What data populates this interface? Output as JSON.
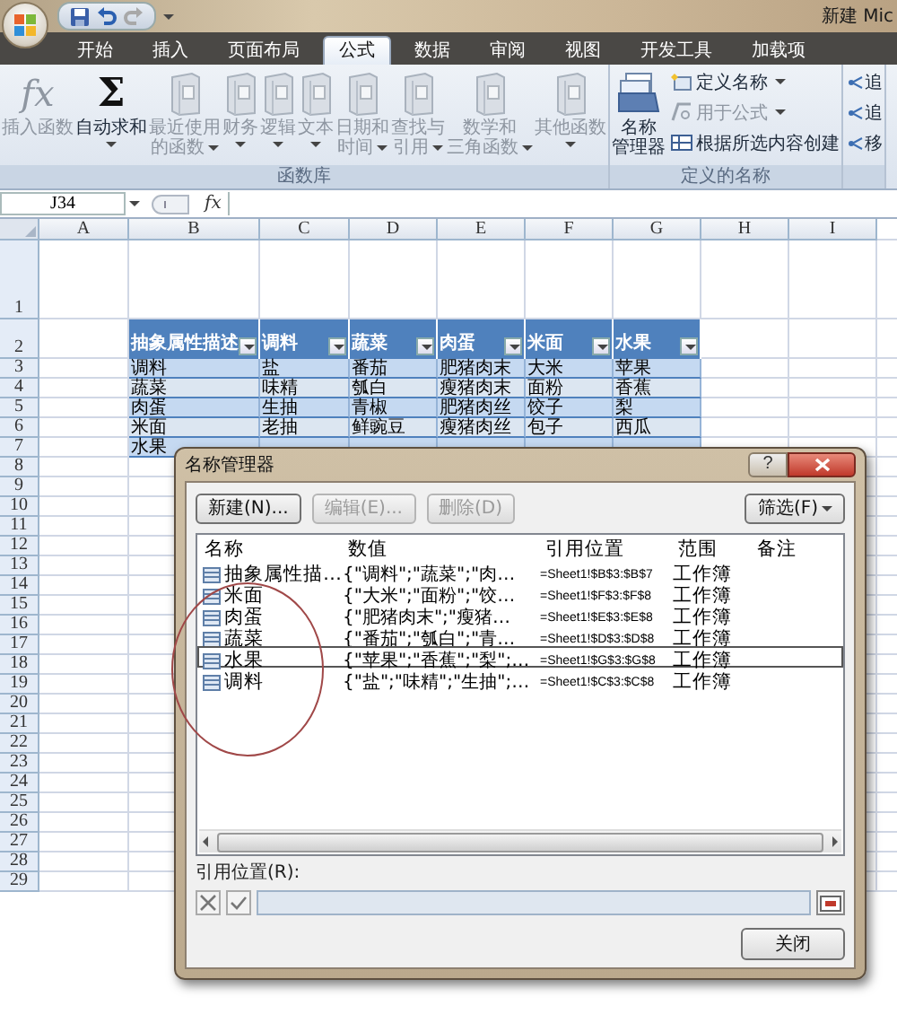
{
  "window": {
    "title": "新建 Mic"
  },
  "quick_access": [
    {
      "kind": "save",
      "disabled": false
    },
    {
      "kind": "undo",
      "disabled": false
    },
    {
      "kind": "redo",
      "disabled": true
    }
  ],
  "tabs": [
    {
      "label": "开始",
      "selected": false
    },
    {
      "label": "插入",
      "selected": false
    },
    {
      "label": "页面布局",
      "selected": false
    },
    {
      "label": "公式",
      "selected": true
    },
    {
      "label": "数据",
      "selected": false
    },
    {
      "label": "审阅",
      "selected": false
    },
    {
      "label": "视图",
      "selected": false
    },
    {
      "label": "开发工具",
      "selected": false
    },
    {
      "label": "加载项",
      "selected": false
    }
  ],
  "ribbon": {
    "groups": [
      {
        "kind": "library",
        "label": "函数库",
        "buttons": [
          {
            "kind": "symbol",
            "symbol": "fx",
            "lines": [
              "插入函数"
            ],
            "disabled": true,
            "dropdown": false
          },
          {
            "kind": "symbol",
            "symbol": "Σ",
            "lines": [
              "自动求和"
            ],
            "disabled": false,
            "dropdown": true
          },
          {
            "kind": "book",
            "lines": [
              "最近使用",
              "的函数"
            ],
            "disabled": true,
            "dropdown": true
          },
          {
            "kind": "book",
            "lines": [
              "财务"
            ],
            "disabled": true,
            "dropdown": true
          },
          {
            "kind": "book",
            "lines": [
              "逻辑"
            ],
            "disabled": true,
            "dropdown": true
          },
          {
            "kind": "book",
            "lines": [
              "文本"
            ],
            "disabled": true,
            "dropdown": true
          },
          {
            "kind": "book",
            "lines": [
              "日期和",
              "时间"
            ],
            "disabled": true,
            "dropdown": true
          },
          {
            "kind": "book",
            "lines": [
              "查找与",
              "引用"
            ],
            "disabled": true,
            "dropdown": true
          },
          {
            "kind": "book",
            "lines": [
              "数学和",
              "三角函数"
            ],
            "disabled": true,
            "dropdown": true
          },
          {
            "kind": "book",
            "lines": [
              "其他函数"
            ],
            "disabled": true,
            "dropdown": true
          }
        ]
      },
      {
        "kind": "names",
        "label": "定义的名称",
        "big_button": {
          "lines": [
            "名称",
            "管理器"
          ]
        },
        "small_buttons": [
          {
            "label": "定义名称",
            "disabled": false,
            "dropdown": true
          },
          {
            "label": "用于公式",
            "disabled": true,
            "dropdown": true
          },
          {
            "label": "根据所选内容创建",
            "disabled": false,
            "dropdown": false
          }
        ]
      },
      {
        "kind": "audit",
        "small_buttons": [
          {
            "label": "追"
          },
          {
            "label": "追"
          },
          {
            "label": "移"
          }
        ]
      }
    ]
  },
  "sheet": {
    "name_box": "J34",
    "fx_label": "fx",
    "columns": [
      "A",
      "B",
      "C",
      "D",
      "E",
      "F",
      "G",
      "H",
      "I"
    ],
    "row_numbers": [
      "1",
      "2",
      "3",
      "4",
      "5",
      "6",
      "7",
      "8",
      "9",
      "10",
      "11",
      "12",
      "13",
      "14",
      "15",
      "16",
      "17",
      "18",
      "19",
      "20",
      "21",
      "22",
      "23",
      "24",
      "25",
      "26",
      "27",
      "28",
      "29"
    ],
    "table": {
      "headers": [
        "抽象属性描述",
        "调料",
        "蔬菜",
        "肉蛋",
        "米面",
        "水果"
      ],
      "rows": [
        [
          "调料",
          "盐",
          "番茄",
          "肥猪肉末",
          "大米",
          "苹果"
        ],
        [
          "蔬菜",
          "味精",
          "瓠白",
          "瘦猪肉末",
          "面粉",
          "香蕉"
        ],
        [
          "肉蛋",
          "生抽",
          "青椒",
          "肥猪肉丝",
          "饺子",
          "梨"
        ],
        [
          "米面",
          "老抽",
          "鲜豌豆",
          "瘦猪肉丝",
          "包子",
          "西瓜"
        ],
        [
          "水果"
        ]
      ]
    }
  },
  "dialog": {
    "title": "名称管理器",
    "help_button": "?",
    "buttons": [
      {
        "label": "新建(N)...",
        "disabled": false
      },
      {
        "label": "编辑(E)...",
        "disabled": true
      },
      {
        "label": "删除(D)",
        "disabled": true
      }
    ],
    "filter_button": "筛选(F)",
    "columns": [
      "名称",
      "数值",
      "引用位置",
      "范围",
      "备注"
    ],
    "rows": [
      {
        "name": "抽象属性描…",
        "value": "{\"调料\";\"蔬菜\";\"肉…",
        "refers_to": "=Sheet1!$B$3:$B$7",
        "scope": "工作簿",
        "selected": false
      },
      {
        "name": "米面",
        "value": "{\"大米\";\"面粉\";\"饺…",
        "refers_to": "=Sheet1!$F$3:$F$8",
        "scope": "工作簿",
        "selected": false
      },
      {
        "name": "肉蛋",
        "value": "{\"肥猪肉末\";\"瘦猪…",
        "refers_to": "=Sheet1!$E$3:$E$8",
        "scope": "工作簿",
        "selected": false
      },
      {
        "name": "蔬菜",
        "value": "{\"番茄\";\"瓠白\";\"青…",
        "refers_to": "=Sheet1!$D$3:$D$8",
        "scope": "工作簿",
        "selected": false
      },
      {
        "name": "水果",
        "value": "{\"苹果\";\"香蕉\";\"梨\";…",
        "refers_to": "=Sheet1!$G$3:$G$8",
        "scope": "工作簿",
        "selected": true
      },
      {
        "name": "调料",
        "value": "{\"盐\";\"味精\";\"生抽\";…",
        "refers_to": "=Sheet1!$C$3:$C$8",
        "scope": "工作簿",
        "selected": false
      }
    ],
    "refers_label": "引用位置(R):",
    "close_button": "关闭"
  }
}
